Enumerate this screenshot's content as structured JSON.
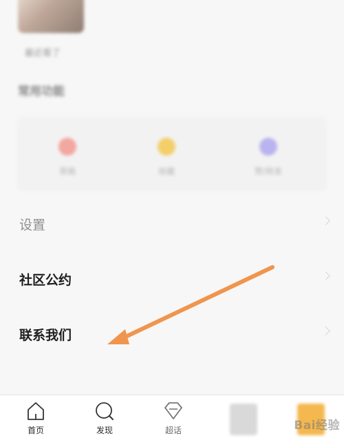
{
  "top": {
    "caption": "最近看了",
    "section_title": "常用功能",
    "tools": [
      {
        "label": "草稿",
        "color": "#f2a7a0",
        "icon": "draft-icon"
      },
      {
        "label": "收藏",
        "color": "#f3cf6a",
        "icon": "favorite-icon"
      },
      {
        "label": "赞/转发",
        "color": "#b9b4ef",
        "icon": "like-icon"
      }
    ]
  },
  "menu": {
    "settings": "设置",
    "community": "社区公约",
    "contact": "联系我们"
  },
  "annotation": {
    "arrow_color": "#f0954e"
  },
  "tabbar": {
    "home": "首页",
    "discover": "发现",
    "chaohua": "超话"
  },
  "watermark": "Bai经验"
}
